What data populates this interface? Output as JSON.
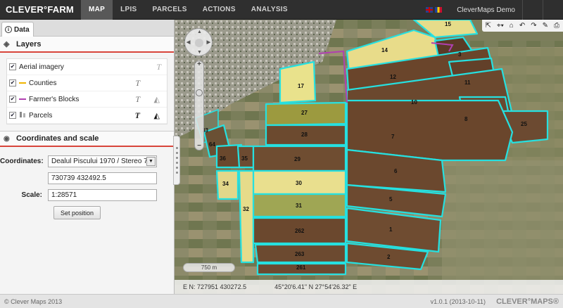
{
  "app": {
    "logo": "CLEVER°FARM",
    "logo_sup": "®",
    "nav": [
      {
        "label": "MAP",
        "active": true
      },
      {
        "label": "LPIS",
        "active": false
      },
      {
        "label": "PARCELS",
        "active": false
      },
      {
        "label": "ACTIONS",
        "active": false
      },
      {
        "label": "ANALYSIS",
        "active": false
      }
    ],
    "user": "CleverMaps Demo",
    "languages": [
      "en",
      "ro"
    ]
  },
  "panel": {
    "tab": "Data",
    "layers_title": "Layers",
    "layers": [
      {
        "label": "Aerial imagery",
        "checked": true,
        "color": ""
      },
      {
        "label": "Counties",
        "checked": true,
        "color": "#f0b400"
      },
      {
        "label": "Farmer's Blocks",
        "checked": true,
        "color": "#b040b0"
      },
      {
        "label": "Parcels",
        "checked": true,
        "color": ""
      }
    ],
    "label_glyph": "T",
    "coords_title": "Coordinates and scale",
    "coordinates_label": "Coordinates:",
    "coordinate_system": "Dealul Piscului 1970 / Stereo 70",
    "coordinates_value": "730739 432492.5",
    "scale_label": "Scale:",
    "scale_value": "1:28571",
    "set_position": "Set position"
  },
  "map": {
    "scale_bar": "750 m",
    "en_coords": "E N: 727951 430272.5",
    "latlon": "45°20'6.41\" N 27°54'26.32\" E",
    "parcel_color": "#26e0e0",
    "block_color": "#b040b0",
    "parcels": [
      "15",
      "14",
      "3",
      "12",
      "11",
      "17",
      "10",
      "8",
      "25",
      "27",
      "7",
      "28",
      "33",
      "64",
      "36",
      "35",
      "29",
      "6",
      "34",
      "30",
      "5",
      "31",
      "32",
      "262",
      "1",
      "263",
      "2",
      "261"
    ]
  },
  "footer": {
    "copyright": "© Clever Maps 2013",
    "version": "v1.0.1 (2013-10-11)",
    "brand": "CLEVER°MAPS®"
  }
}
